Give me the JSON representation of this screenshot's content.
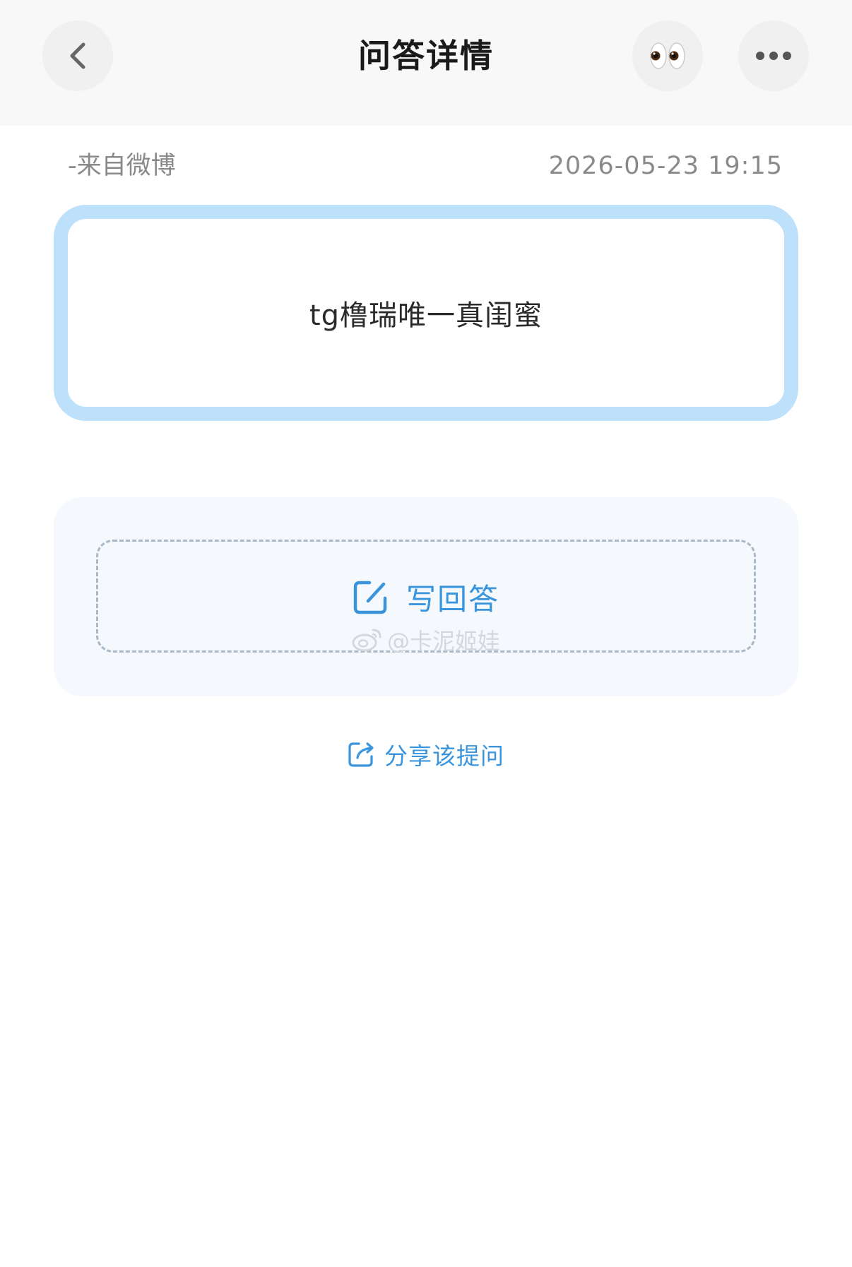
{
  "header": {
    "title": "问答详情",
    "back_icon": "chevron-left-icon",
    "eyes_emoji": "👀",
    "more_icon": "more-horizontal-icon"
  },
  "meta": {
    "source": "-来自微博",
    "timestamp": "2026-05-23 19:15"
  },
  "question": {
    "text": "tg橹瑞唯一真闺蜜"
  },
  "answer": {
    "write_label": "写回答",
    "write_icon": "edit-icon"
  },
  "watermark": {
    "text": "@卡泥姬娃",
    "icon": "weibo-logo-icon"
  },
  "share": {
    "label": "分享该提问",
    "icon": "share-icon"
  },
  "colors": {
    "accent_blue": "#3a95dd",
    "card_border": "#bde0fb",
    "panel_bg": "#f5f8fc",
    "header_bg": "#f8f8f8"
  }
}
